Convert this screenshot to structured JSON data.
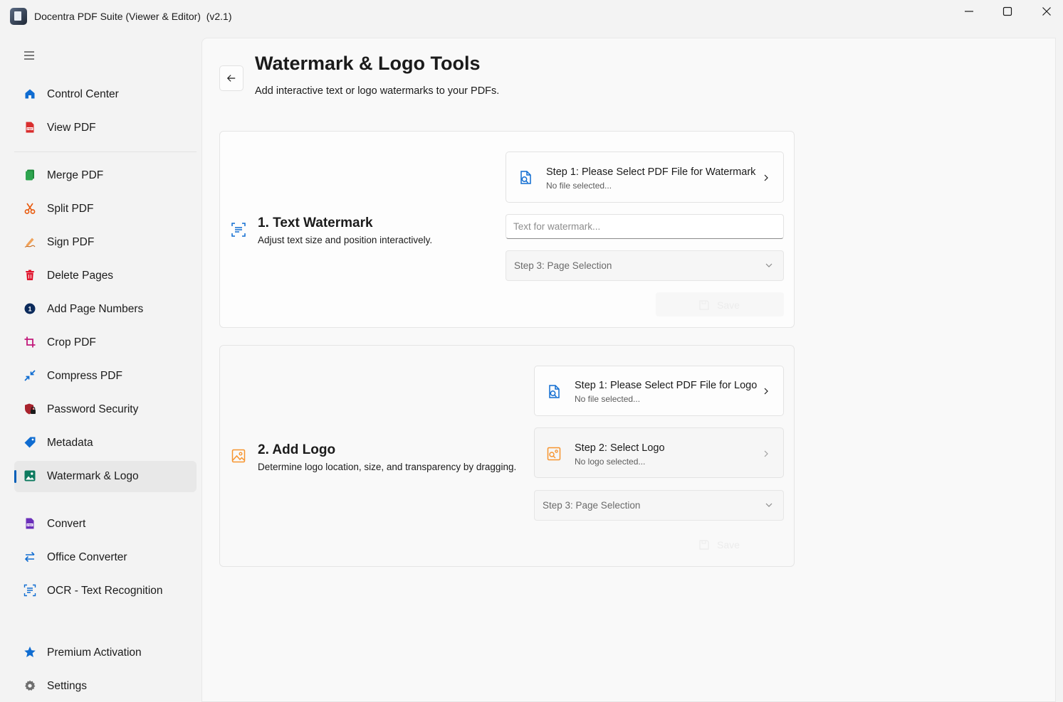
{
  "window": {
    "title": "Docentra PDF Suite (Viewer & Editor)  (v2.1)"
  },
  "sidebar": {
    "items": [
      {
        "label": "Control Center",
        "icon": "home-icon"
      },
      {
        "label": "View PDF",
        "icon": "pdf-icon"
      },
      {
        "label": "Merge PDF",
        "icon": "merge-icon"
      },
      {
        "label": "Split PDF",
        "icon": "scissors-icon"
      },
      {
        "label": "Sign PDF",
        "icon": "signature-icon"
      },
      {
        "label": "Delete Pages",
        "icon": "trash-icon"
      },
      {
        "label": "Add Page Numbers",
        "icon": "number-icon"
      },
      {
        "label": "Crop PDF",
        "icon": "crop-icon"
      },
      {
        "label": "Compress PDF",
        "icon": "compress-icon"
      },
      {
        "label": "Password Security",
        "icon": "shield-lock-icon"
      },
      {
        "label": "Metadata",
        "icon": "tag-icon"
      },
      {
        "label": "Watermark & Logo",
        "icon": "image-icon",
        "active": true
      },
      {
        "label": "Convert",
        "icon": "convert-icon"
      },
      {
        "label": "Office Converter",
        "icon": "swap-icon"
      },
      {
        "label": "OCR - Text Recognition",
        "icon": "scan-text-icon"
      },
      {
        "label": "Premium Activation",
        "icon": "star-icon"
      },
      {
        "label": "Settings",
        "icon": "gear-icon"
      }
    ]
  },
  "header": {
    "title": "Watermark & Logo Tools",
    "subtitle": "Add interactive text or logo watermarks to your PDFs."
  },
  "text_watermark": {
    "title": "1. Text Watermark",
    "description": "Adjust text size and position interactively.",
    "step1_title": "Step 1: Please Select PDF File for Watermark",
    "step1_status": "No file selected...",
    "text_placeholder": "Text for watermark...",
    "page_selection": "Step 3: Page Selection",
    "save_label": "Save"
  },
  "logo": {
    "title": "2. Add Logo",
    "description": "Determine logo location, size, and transparency by dragging.",
    "step1_title": "Step 1: Please Select PDF File for Logo",
    "step1_status": "No file selected...",
    "step2_title": "Step 2: Select Logo",
    "step2_status": "No logo selected...",
    "page_selection": "Step 3: Page Selection",
    "save_label": "Save"
  },
  "colors": {
    "accent": "#005fb8",
    "logo_accent": "#f7942e",
    "active_nav_bg": "#e8e8e8"
  }
}
